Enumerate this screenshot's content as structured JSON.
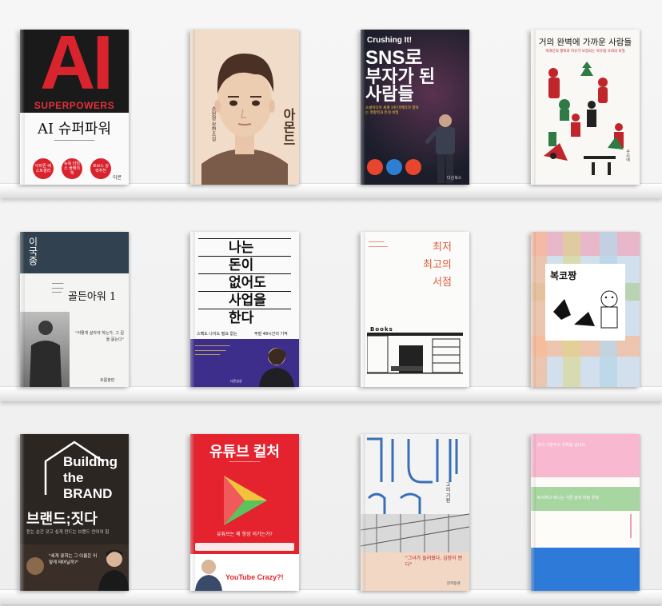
{
  "books": {
    "b1": {
      "big": "AI",
      "word": "SUPERPOWERS",
      "title": "AI 슈퍼파워",
      "badges": [
        "아마존 베스트셀러",
        "뉴욕 타임스 올해의 책",
        "포브스 강력추천"
      ],
      "publisher": "이콘"
    },
    "b2": {
      "title": "아몬드",
      "author": "손원평 장편소설"
    },
    "b3": {
      "top": "Crushing It!",
      "line1": "SNS로",
      "line2": "부자가 된",
      "line3": "사람들",
      "subtitle": "소셜미디어 세계 1위 마케터가 말하는 영향력과 돈의 비밀",
      "publisher": "다산북스"
    },
    "b4": {
      "title": "거의 완벽에 가까운 사람들",
      "subtitle": "개개인의 행복과 자유가 보장되는 북유럽 사회의 비밀",
      "publisher": "꾸리에"
    },
    "b5": {
      "author": "이국종",
      "title": "골든아워 1",
      "quote": "\"어떻게 살아야 하는가, 그 길을 묻는다\"",
      "publisher": "흐름출판"
    },
    "b6": {
      "title": [
        "나는",
        "돈이",
        "없어도",
        "사업을",
        "한다"
      ],
      "tag1": "스펙도 나이도 필요 없는",
      "tag2": "주말 48시간의 기적",
      "publisher": "다른상상"
    },
    "b7": {
      "title": [
        "최저",
        "최고의",
        "서점"
      ],
      "sign": "Books"
    },
    "b8": {
      "title": "복코짱"
    },
    "b9": {
      "line1": "Building",
      "line2": "the",
      "line3": "BRAND",
      "title": "브랜드;짓다",
      "subtitle": "듣는 순간 갖고 싶게 만드는 브랜드 언어의 힘",
      "quote": "\"세게 꽂히는 그 이름은 어떻게 태어날까?\""
    },
    "b10": {
      "title": "유튜브 컬처",
      "question": "유튜브는 왜 항상 이기는가?",
      "crazy": "YouTube Crazy?!"
    },
    "b11": {
      "title": "고의 기원",
      "quote": "\"그녀가 들려줬다, 심장이 뛴다\"",
      "publisher": "문학동네"
    },
    "b12": {
      "title": "퇴사하고 떠나는 서른 살의 미술 유학",
      "top": "회사 그만두고 유학을 갑니다."
    }
  }
}
